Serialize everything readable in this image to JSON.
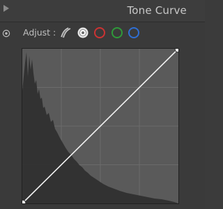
{
  "panel": {
    "title": "Tone Curve"
  },
  "toolbar": {
    "adjust_label": "Adjust :",
    "channels": [
      {
        "id": "parametric",
        "icon": "parametric-curve-icon",
        "color": "#d0d0d0",
        "selected": false
      },
      {
        "id": "rgb",
        "icon": "point-curve-rgb-icon",
        "color": "#e0e0e0",
        "selected": true
      },
      {
        "id": "red",
        "icon": "red-channel-icon",
        "color": "#cc3333",
        "selected": false
      },
      {
        "id": "green",
        "icon": "green-channel-icon",
        "color": "#2f9a3a",
        "selected": false
      },
      {
        "id": "blue",
        "icon": "blue-channel-icon",
        "color": "#2f6fd4",
        "selected": false
      }
    ]
  },
  "colors": {
    "panel_bg": "#3a3a3a",
    "graph_bg": "#5a5a5a",
    "histogram": "#2e2e2e",
    "curve": "#f2f2f2"
  },
  "curve": {
    "points": [
      [
        0,
        0
      ],
      [
        255,
        255
      ]
    ]
  }
}
